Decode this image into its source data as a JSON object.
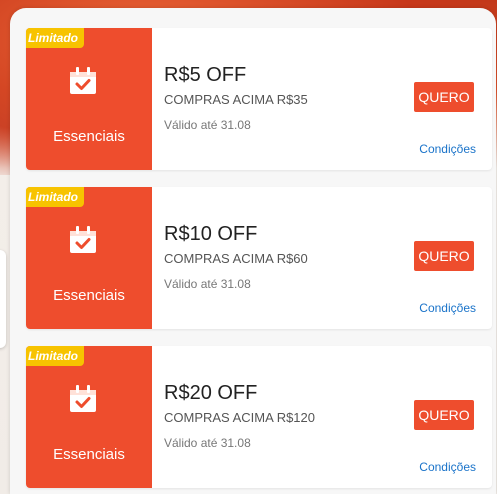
{
  "colors": {
    "accent": "#ee4d2d",
    "badge": "#f7c300",
    "link": "#1a73c9"
  },
  "coupons": [
    {
      "badge": "Limitado",
      "icon": "calendar-check-icon",
      "category": "Essenciais",
      "title": "R$5 OFF",
      "min_purchase": "COMPRAS ACIMA R$35",
      "validity": "Válido até 31.08",
      "button": "QUERO",
      "conditions": "Condições"
    },
    {
      "badge": "Limitado",
      "icon": "calendar-check-icon",
      "category": "Essenciais",
      "title": "R$10 OFF",
      "min_purchase": "COMPRAS ACIMA R$60",
      "validity": "Válido até 31.08",
      "button": "QUERO",
      "conditions": "Condições"
    },
    {
      "badge": "Limitado",
      "icon": "calendar-check-icon",
      "category": "Essenciais",
      "title": "R$20 OFF",
      "min_purchase": "COMPRAS ACIMA R$120",
      "validity": "Válido até 31.08",
      "button": "QUERO",
      "conditions": "Condições"
    }
  ]
}
